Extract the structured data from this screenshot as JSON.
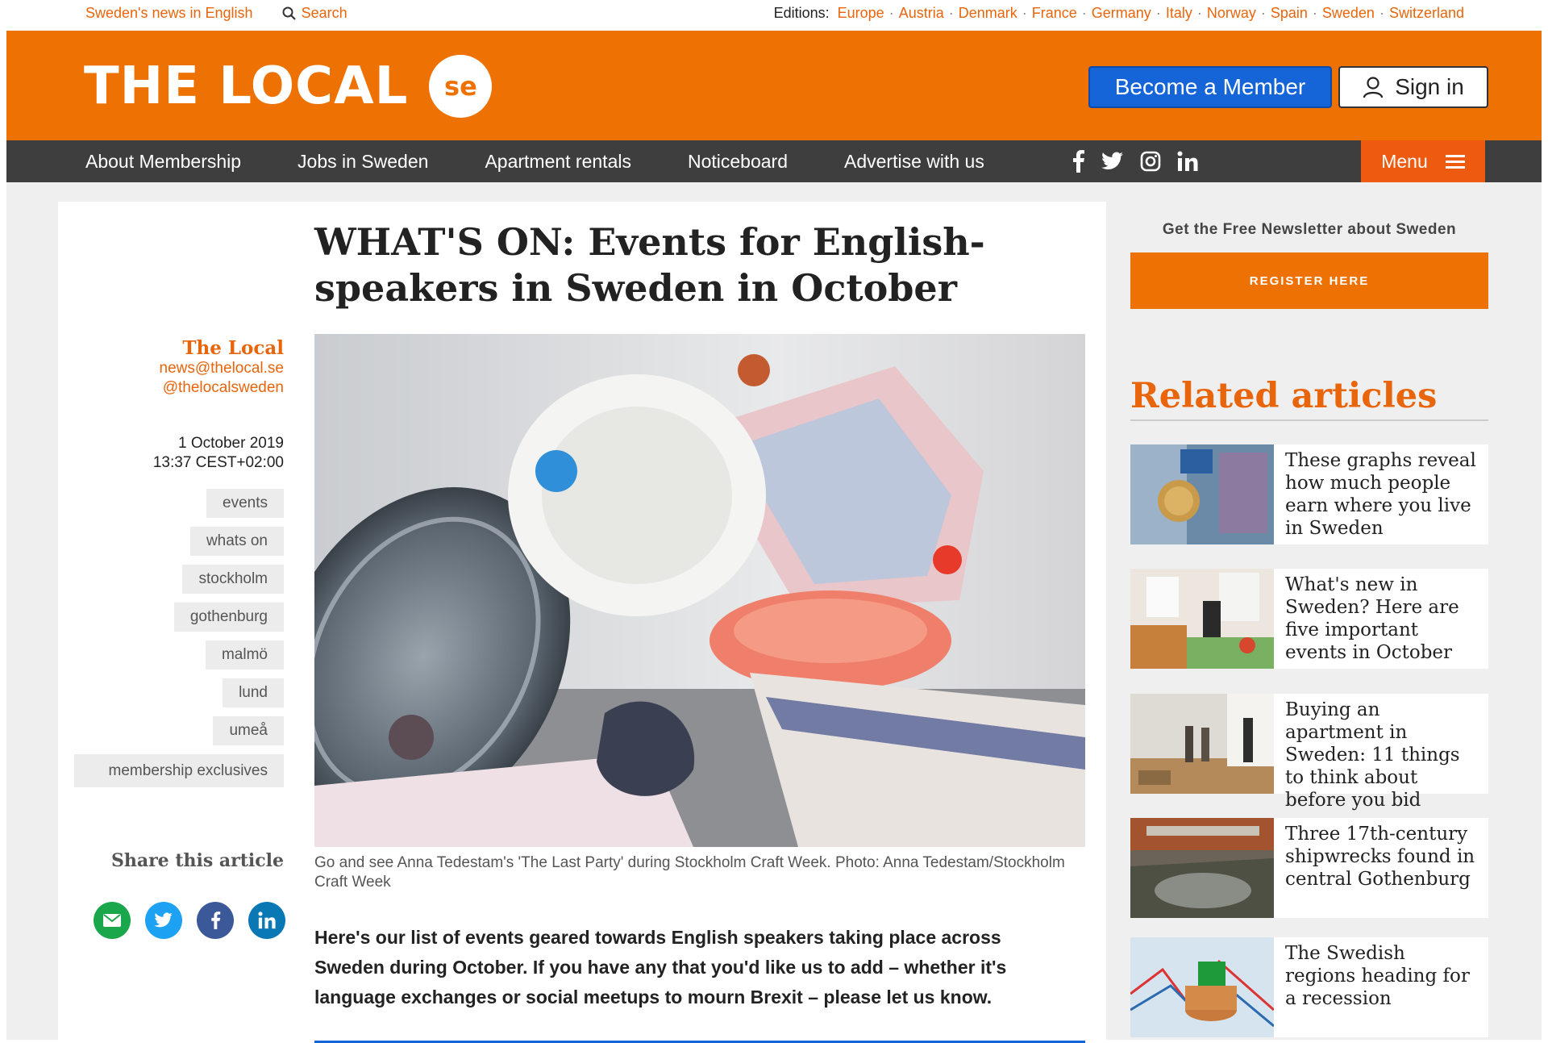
{
  "utility": {
    "tagline": "Sweden's news in English",
    "search": "Search",
    "editions_label": "Editions:",
    "editions": [
      "Europe",
      "Austria",
      "Denmark",
      "France",
      "Germany",
      "Italy",
      "Norway",
      "Spain",
      "Sweden",
      "Switzerland"
    ]
  },
  "header": {
    "logo_word": "THE LOCAL",
    "logo_badge": "se",
    "member_button": "Become a Member",
    "signin_button": "Sign in"
  },
  "nav": {
    "items": [
      "About Membership",
      "Jobs in Sweden",
      "Apartment rentals",
      "Noticeboard",
      "Advertise with us"
    ],
    "menu": "Menu",
    "social": [
      "facebook-icon",
      "twitter-icon",
      "instagram-icon",
      "linkedin-icon"
    ]
  },
  "article": {
    "title": "WHAT'S ON: Events for English-speakers in Sweden in October",
    "author_name": "The Local",
    "author_email": "news@thelocal.se",
    "author_twitter": "@thelocalsweden",
    "date": "1 October 2019",
    "time": "13:37 CEST+02:00",
    "tags": [
      "events",
      "whats on",
      "stockholm",
      "gothenburg",
      "malmö",
      "lund",
      "umeå",
      "membership exclusives"
    ],
    "share_label": "Share this article",
    "caption": "Go and see Anna Tedestam's 'The Last Party' during Stockholm Craft Week. Photo: Anna Tedestam/Stockholm Craft Week",
    "lede": "Here's our list of events geared towards English speakers taking place across Sweden during October. If you have any that you'd like us to add – whether it's language exchanges or social meetups to mourn Brexit – please let us know."
  },
  "sidebar": {
    "newsletter_label": "Get the Free Newsletter about Sweden",
    "newsletter_button": "REGISTER HERE",
    "related_title": "Related articles",
    "related": [
      "These graphs reveal how much people earn where you live in Sweden",
      "What's new in Sweden? Here are five important events in October",
      "Buying an apartment in Sweden: 11 things to think about before you bid",
      "Three 17th-century shipwrecks found in central Gothenburg",
      "The Swedish regions heading for a recession"
    ]
  },
  "colors": {
    "brand_orange": "#ee7203",
    "nav_dark": "#3e3e3e",
    "member_blue": "#1565d8",
    "link_orange": "#e9650c"
  }
}
